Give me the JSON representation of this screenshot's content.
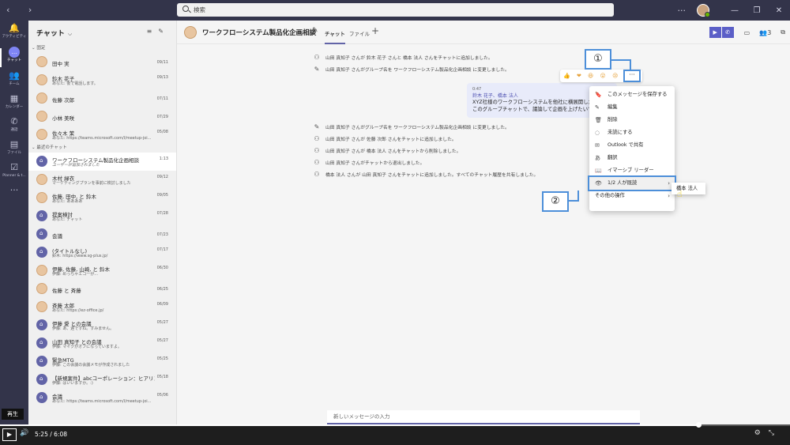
{
  "titlebar": {
    "search_placeholder": "検索",
    "more": "···",
    "win_minimize": "—",
    "win_restore": "❐",
    "win_close": "✕"
  },
  "rail": [
    {
      "label": "アクティビティ",
      "icon": "bell-icon",
      "glyph": "🔔"
    },
    {
      "label": "チャット",
      "icon": "chat-icon",
      "glyph": "…"
    },
    {
      "label": "チーム",
      "icon": "teams-icon",
      "glyph": "👥"
    },
    {
      "label": "カレンダー",
      "icon": "calendar-icon",
      "glyph": "▦"
    },
    {
      "label": "通話",
      "icon": "phone-icon",
      "glyph": "✆"
    },
    {
      "label": "ファイル",
      "icon": "file-icon",
      "glyph": "▤"
    },
    {
      "label": "Planner & t...",
      "icon": "planner-icon",
      "glyph": "☑"
    },
    {
      "label": "",
      "icon": "more-icon",
      "glyph": "···"
    }
  ],
  "chatlist": {
    "title": "チャット",
    "sections": {
      "pinned": "固定",
      "recent": "最近のチャット"
    },
    "pinned": [
      {
        "name": "田中 実",
        "preview": "",
        "date": "09/11"
      },
      {
        "name": "鈴木 花子",
        "preview": "あなた: 後で電話します。",
        "date": "09/13"
      },
      {
        "name": "佐藤 次郎",
        "preview": "",
        "date": "07/11"
      },
      {
        "name": "小林 美咲",
        "preview": "",
        "date": "07/29"
      },
      {
        "name": "佐々木 茉",
        "preview": "あなた: https://teams.microsoft.com/l/meetup-joi...",
        "date": "05/08"
      }
    ],
    "recent": [
      {
        "name": "ワークフローシステム製品化企画相談",
        "preview": "ユーザーが追加されました",
        "date": "1:13",
        "group": true
      },
      {
        "name": "木村 緑衣",
        "preview": "マーケティングプランを事前に検討しました",
        "date": "09/12"
      },
      {
        "name": "佐藤, 田中, と 鈴木",
        "preview": "あなた: ああああ",
        "date": "09/05"
      },
      {
        "name": "提案検討",
        "preview": "あなた: チャット",
        "date": "07/28",
        "group": true
      },
      {
        "name": "会議",
        "preview": "",
        "date": "07/23",
        "group": true
      },
      {
        "name": "(タイトルなし)",
        "preview": "鈴木: https://www.sg-plus.jp/",
        "date": "07/17",
        "group": true
      },
      {
        "name": "伊藤, 佐藤, 山崎, と 鈴木",
        "preview": "伊藤: めっちゃエコーが...",
        "date": "06/30"
      },
      {
        "name": "佐藤 と 斉藤",
        "preview": "",
        "date": "06/25"
      },
      {
        "name": "斉藤 太郎",
        "preview": "あなた: https://ez-office.jp/",
        "date": "06/09"
      },
      {
        "name": "伊藤 愛 との会議",
        "preview": "伊藤: あ、遅ですね。すみません。",
        "date": "05/27",
        "group": true
      },
      {
        "name": "山田 真知子 との会議",
        "preview": "伊藤: マイクがオフになっていますよ。",
        "date": "05/27",
        "group": true
      },
      {
        "name": "緊急MTG",
        "preview": "伊藤: この会議の会議メモが作成されました",
        "date": "05/25",
        "group": true
      },
      {
        "name": "【新規案件】abcコーポレーション：ヒアリン...",
        "preview": "伊藤: はいいますか。:)",
        "date": "05/18",
        "group": true
      },
      {
        "name": "会議",
        "preview": "あなた: https://teams.microsoft.com/l/meetup-joi...",
        "date": "05/06",
        "group": true
      }
    ]
  },
  "header": {
    "title": "ワークフローシステム製品化企画相談",
    "tabs": [
      "チャット",
      "ファイル"
    ],
    "participants": "3"
  },
  "messages": {
    "system": [
      "山田 真知子 さんが 鈴木 花子 さんと 橋本 法人 さんをチャットに追加しました。",
      "山田 真知子 さんがグループ名を ワークフローシステム製品化企画相談 に変更しました。",
      "山田 真知子 さんがグループ名を ワークフローシステム製品化企画相談 に変更しました。",
      "山田 真知子 さんが 佐藤 次郎 さんをチャットに追加しました。",
      "山田 真知子 さんが 橋本 法人 さんをチャットから削除しました。",
      "山田 真知子 さんがチャットから退出しました。",
      "橋本 法人 さんが 山田 真知子 さんをチャットに追加しました。すべてのチャット履歴を共有しました。"
    ],
    "bubble": {
      "time": "0:47",
      "to": "鈴木 花子、橋本 法人",
      "line1": "XYZ社様のワークフローシステムを他社に横展開したい",
      "line2": "このグループチャットで、議論して企画を上げたいで"
    }
  },
  "reactions": "👍 ❤ 😆 😮 😢 😠",
  "context_menu": [
    {
      "label": "このメッセージを保存する",
      "icon": "bookmark-icon",
      "glyph": "🔖"
    },
    {
      "label": "編集",
      "icon": "pencil-icon",
      "glyph": "✎"
    },
    {
      "label": "削除",
      "icon": "trash-icon",
      "glyph": "🗑"
    },
    {
      "label": "未読にする",
      "icon": "unread-icon",
      "glyph": "◌"
    },
    {
      "label": "Outlook で共有",
      "icon": "outlook-icon",
      "glyph": "✉"
    },
    {
      "label": "翻訳",
      "icon": "translate-icon",
      "glyph": "あ"
    },
    {
      "label": "イマーシブ リーダー",
      "icon": "reader-icon",
      "glyph": "📖"
    },
    {
      "label": "1/2 人が既読",
      "icon": "eye-icon",
      "glyph": "👁",
      "submenu": true
    },
    {
      "label": "その他の操作",
      "icon": "",
      "glyph": "",
      "submenu": true
    }
  ],
  "submenu_item": "橋本 法人",
  "callouts": {
    "one": "①",
    "two": "②"
  },
  "compose": {
    "placeholder": "新しいメッセージの入力"
  },
  "player": {
    "replay_label": "再生",
    "current": "5:25",
    "separator": "/",
    "total": "6:08",
    "progress": 0.884
  }
}
